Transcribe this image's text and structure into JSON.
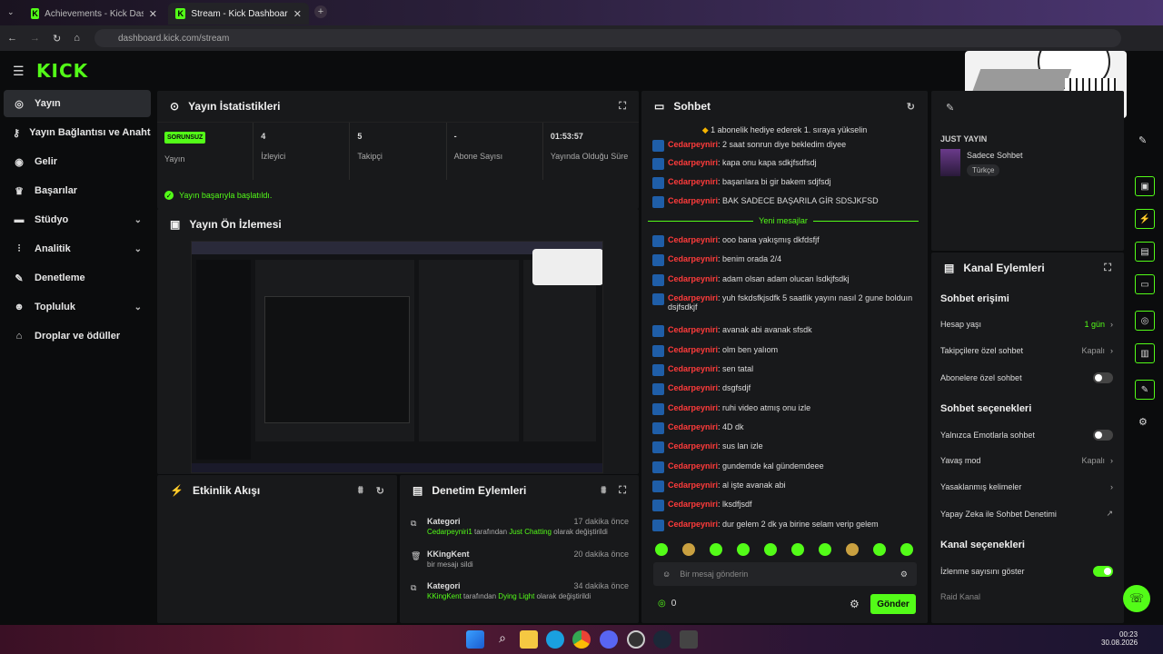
{
  "browser": {
    "tabs": [
      {
        "label": "Achievements - Kick Dashboard"
      },
      {
        "label": "Stream - Kick Dashboard"
      }
    ],
    "url": "dashboard.kick.com/stream"
  },
  "header": {
    "logo": "KICK"
  },
  "sidebar": {
    "items": [
      {
        "label": "Yayın",
        "icon": "broadcast-icon"
      },
      {
        "label": "Yayın Bağlantısı ve Anahtar",
        "icon": "key-icon"
      },
      {
        "label": "Gelir",
        "icon": "money-icon"
      },
      {
        "label": "Başarılar",
        "icon": "trophy-icon"
      },
      {
        "label": "Stüdyo",
        "icon": "studio-icon"
      },
      {
        "label": "Analitik",
        "icon": "chart-icon"
      },
      {
        "label": "Denetleme",
        "icon": "wrench-icon"
      },
      {
        "label": "Topluluk",
        "icon": "community-icon"
      },
      {
        "label": "Droplar ve ödüller",
        "icon": "gift-icon"
      }
    ]
  },
  "stats_panel": {
    "title": "Yayın İstatistikleri",
    "stats": [
      {
        "value": "SORUNSUZ",
        "label": "Yayın"
      },
      {
        "value": "4",
        "label": "İzleyici"
      },
      {
        "value": "5",
        "label": "Takipçi"
      },
      {
        "value": "-",
        "label": "Abone Sayısı"
      },
      {
        "value": "01:53:57",
        "label": "Yayında Olduğu Süre"
      }
    ],
    "success": "Yayın başarıyla başlatıldı."
  },
  "preview_panel": {
    "title": "Yayın Ön İzlemesi"
  },
  "activity_panel": {
    "title": "Etkinlik Akışı"
  },
  "moderation_panel": {
    "title": "Denetim Eylemleri",
    "items": [
      {
        "title": "Kategori",
        "time": "17 dakika önce",
        "by": "Cedarpeyniri1",
        "mid": " tarafından ",
        "value": "Just Chatting",
        "end": " olarak değiştirildi"
      },
      {
        "title": "KKingKent",
        "time": "20 dakika önce",
        "by": "",
        "mid": "bir mesajı sildi",
        "value": "",
        "end": ""
      },
      {
        "title": "Kategori",
        "time": "34 dakika önce",
        "by": "KKingKent",
        "mid": " tarafından ",
        "value": "Dying Light",
        "end": " olarak değiştirildi"
      }
    ]
  },
  "chat": {
    "title": "Sohbet",
    "banner": "1 abonelik hediye ederek 1. sıraya yükselin",
    "new_messages": "Yeni mesajlar",
    "messages": [
      {
        "user": "Cedarpeyniri",
        "text": "2 saat sonrun diye bekledim diyee"
      },
      {
        "user": "Cedarpeyniri",
        "text": "kapa onu kapa sdkjfsdfsdj"
      },
      {
        "user": "Cedarpeyniri",
        "text": "başarılara bi gir bakem sdjfsdj"
      },
      {
        "user": "Cedarpeyniri",
        "text": "BAK SADECE BAŞARILA GİR SDSJKFSD"
      },
      {
        "user": "Cedarpeyniri",
        "text": "ooo bana yakışmış dkfdsfjf"
      },
      {
        "user": "Cedarpeyniri",
        "text": "benim orada 2/4"
      },
      {
        "user": "Cedarpeyniri",
        "text": "adam olsan adam olucan lsdkjfsdkj"
      },
      {
        "user": "Cedarpeyniri",
        "text": "yuh fskdsfkjsdfk 5 saatlik yayını nasıl 2 gune bolduın dsjfsdkjf"
      },
      {
        "user": "Cedarpeyniri",
        "text": "avanak abi avanak sfsdk"
      },
      {
        "user": "Cedarpeyniri",
        "text": "olm ben yalıom"
      },
      {
        "user": "Cedarpeyniri",
        "text": "sen tatal"
      },
      {
        "user": "Cedarpeyniri",
        "text": "dsgfsdjf"
      },
      {
        "user": "Cedarpeyniri",
        "text": "ruhi video atmış onu izle"
      },
      {
        "user": "Cedarpeyniri",
        "text": "4D dk"
      },
      {
        "user": "Cedarpeyniri",
        "text": "sus lan izle"
      },
      {
        "user": "Cedarpeyniri",
        "text": "gundemde kal gündemdeee"
      },
      {
        "user": "Cedarpeyniri",
        "text": "al işte avanak abi"
      },
      {
        "user": "Cedarpeyniri",
        "text": "lksdfjsdf"
      },
      {
        "user": "Cedarpeyniri",
        "text": "dur gelem 2 dk ya birine selam verip gelem"
      }
    ],
    "placeholder": "Bir mesaj gönderin",
    "count": "0",
    "send": "Gönder"
  },
  "right": {
    "just_label": "JUST YAYIN",
    "title": "Sadece Sohbet",
    "lang": "Türkçe",
    "channel_title": "Kanal Eylemleri",
    "chat_access": "Sohbet erişimi",
    "rows": [
      {
        "label": "Hesap yaşı",
        "value": "1 gün",
        "kind": "link"
      },
      {
        "label": "Takipçilere özel sohbet",
        "value": "Kapalı",
        "kind": "link"
      },
      {
        "label": "Abonelere özel sohbet",
        "value": "",
        "kind": "off"
      }
    ],
    "chat_options": "Sohbet seçenekleri",
    "rows2": [
      {
        "label": "Yalnızca Emotlarla sohbet",
        "value": "",
        "kind": "off"
      },
      {
        "label": "Yavaş mod",
        "value": "Kapalı",
        "kind": "link"
      },
      {
        "label": "Yasaklanmış kelimeler",
        "value": "",
        "kind": "link"
      },
      {
        "label": "Yapay Zeka ile Sohbet Denetimi",
        "value": "",
        "kind": "ext"
      }
    ],
    "channel_options": "Kanal seçenekleri",
    "rows3": [
      {
        "label": "İzlenme sayısını göster",
        "value": "",
        "kind": "on"
      },
      {
        "label": "Raid Kanal",
        "value": "",
        "kind": "none"
      }
    ]
  },
  "taskbar": {
    "time": "00:23",
    "date": "30.08.2026"
  }
}
